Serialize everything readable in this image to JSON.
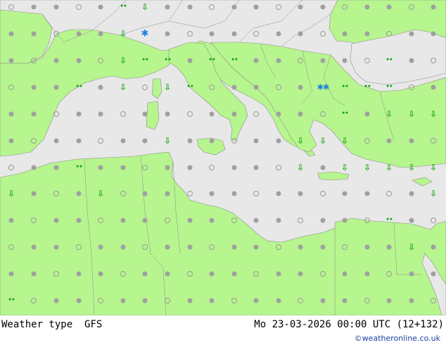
{
  "map": {
    "colors": {
      "land": "#b7f58e",
      "sea": "#e8e8e8",
      "border": "#8d8d8d",
      "cloud_symbol": "#a0a0a0",
      "rain_symbol": "#18a818",
      "snow_symbol": "#1f7fe0"
    },
    "legend_icons": [
      "cloud-icon",
      "half-cloud-icon",
      "clear-icon",
      "drizzle-icon",
      "shower-icon",
      "snow-icon",
      "thunder-icon"
    ]
  },
  "footer": {
    "left_label": "Weather type",
    "model": "GFS",
    "datetime": "Mo 23-03-2026 00:00 UTC (12+132)",
    "credit": "©weatheronline.co.uk"
  }
}
